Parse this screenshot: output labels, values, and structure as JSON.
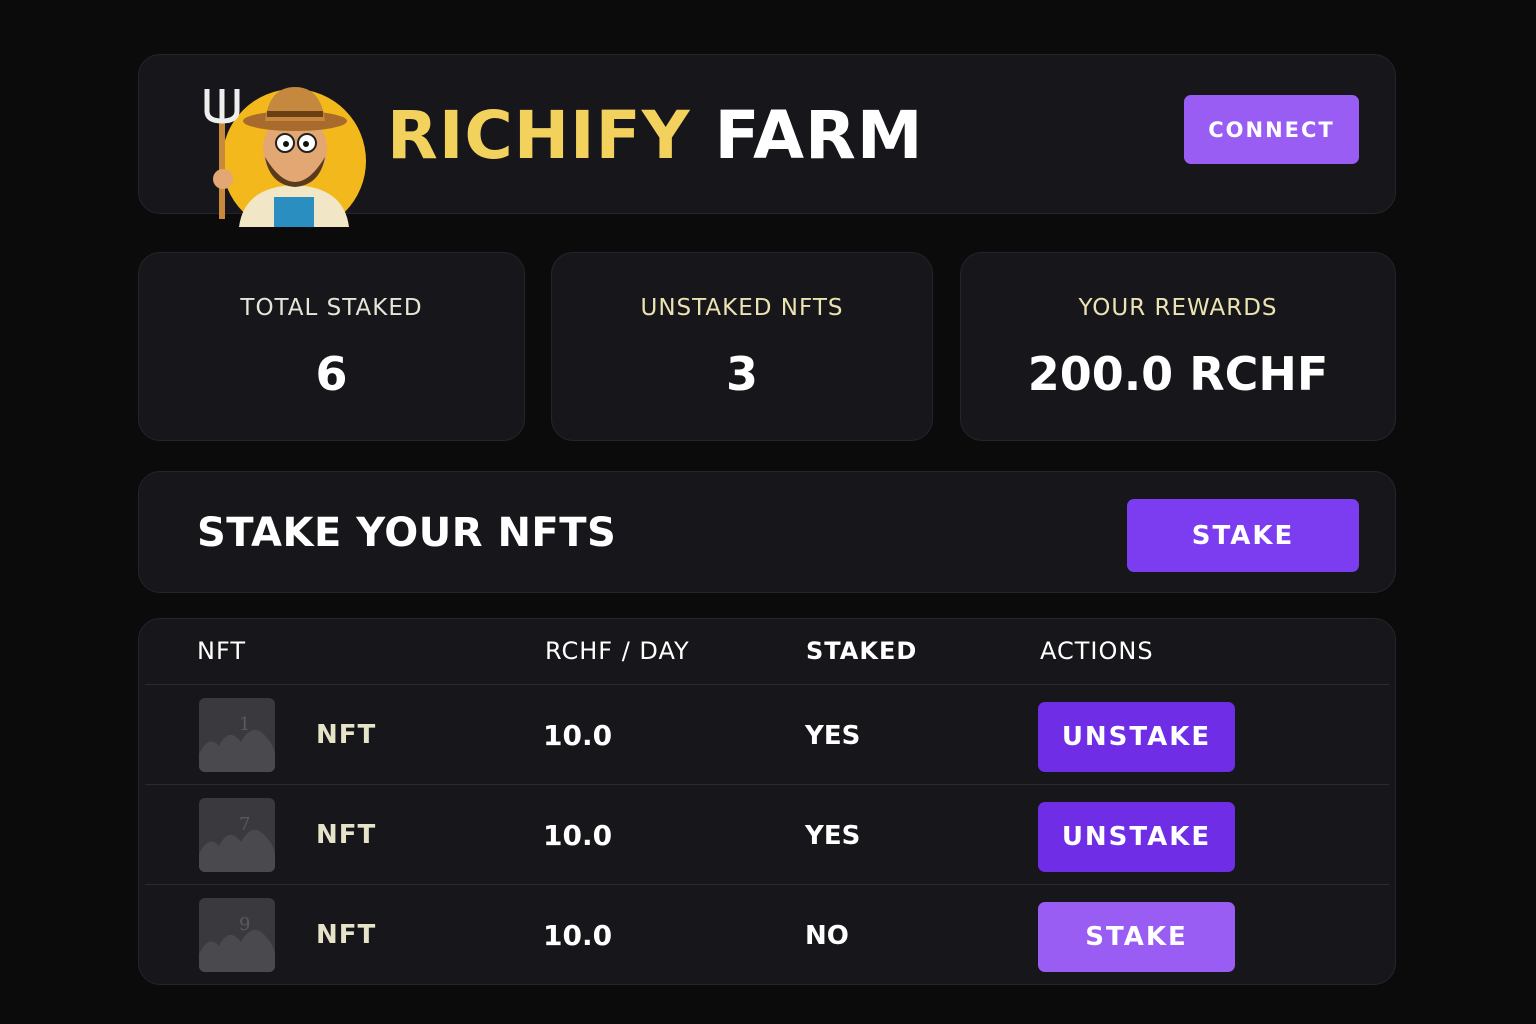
{
  "header": {
    "brand_part1": "RICHIFY",
    "brand_part2": "FARM",
    "connect_label": "CONNECT"
  },
  "stats": [
    {
      "label": "TOTAL STAKED",
      "value": "6"
    },
    {
      "label": "UNSTAKED NFTS",
      "value": "3"
    },
    {
      "label": "YOUR REWARDS",
      "value": "200.0 RCHF"
    }
  ],
  "stake_section": {
    "title": "STAKE YOUR NFTS",
    "button_label": "STAKE"
  },
  "table": {
    "headers": [
      "NFT",
      "RCHF / DAY",
      "STAKED",
      "ACTIONS"
    ],
    "rows": [
      {
        "thumb_glyph": "1",
        "name": "NFT",
        "rate": "10.0",
        "staked": "YES",
        "action": "UNSTAKE"
      },
      {
        "thumb_glyph": "7",
        "name": "NFT",
        "rate": "10.0",
        "staked": "YES",
        "action": "UNSTAKE"
      },
      {
        "thumb_glyph": "9",
        "name": "NFT",
        "rate": "10.0",
        "staked": "NO",
        "action": "STAKE"
      }
    ]
  },
  "colors": {
    "accent_yellow": "#f2d15c",
    "button_purple_light": "#9a5df4",
    "button_purple_dark": "#6f2ee6",
    "card_bg": "#17171b",
    "page_bg": "#0b0b0c"
  },
  "icons": {
    "logo": "farmer-with-pitchfork-logo",
    "thumbnail": "image-placeholder-icon"
  }
}
